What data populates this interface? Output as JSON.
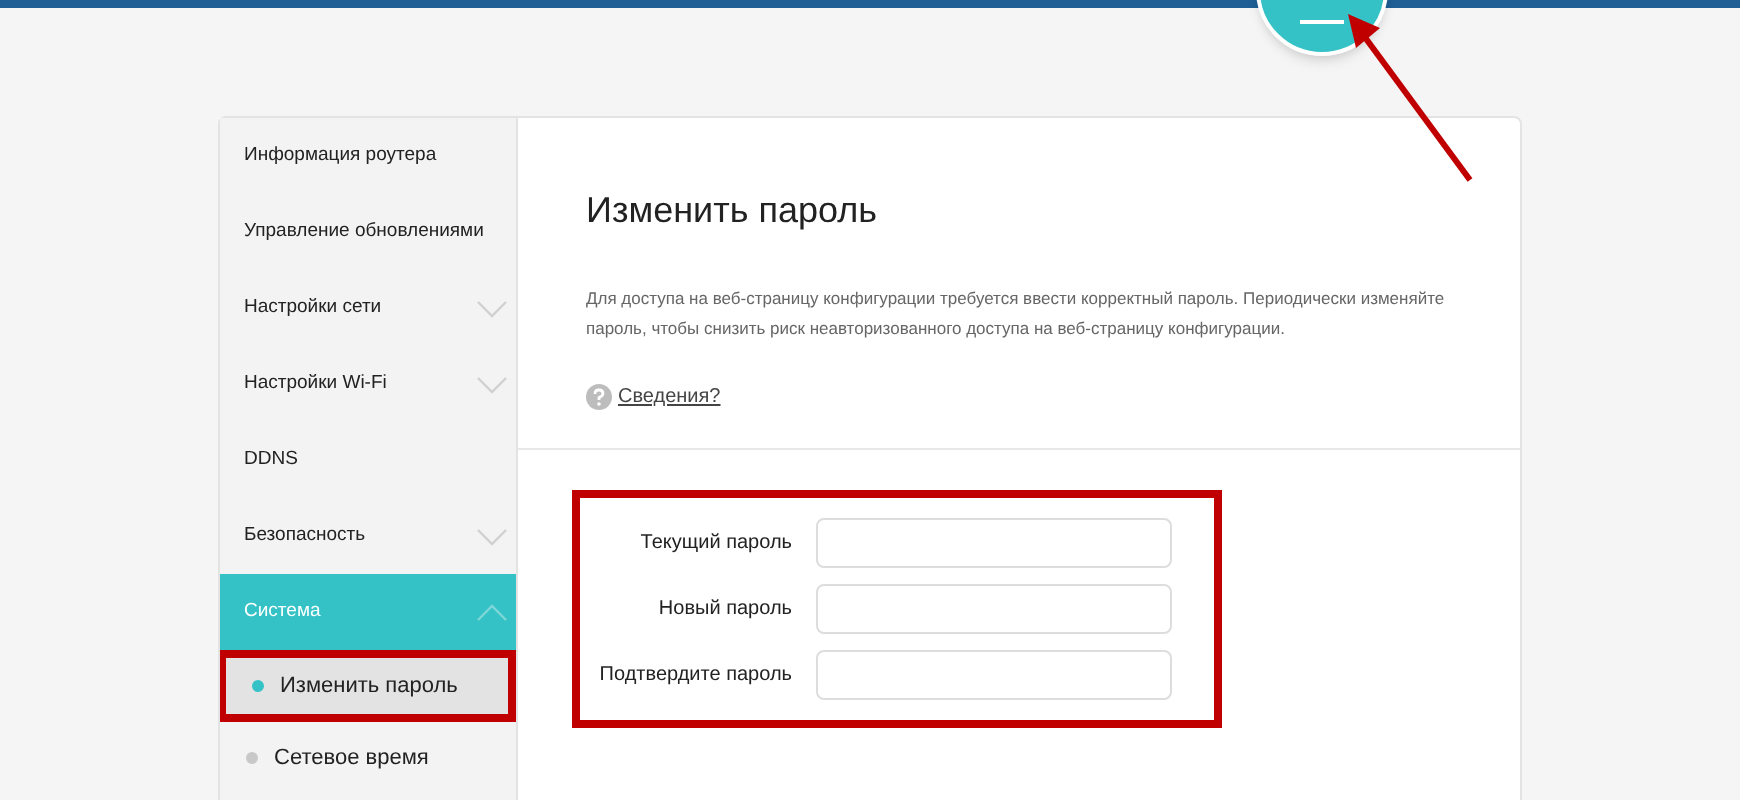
{
  "sidebar": {
    "items": [
      {
        "label": "Информация роутера",
        "kind": "item",
        "selected": false
      },
      {
        "label": "Управление обновлениями",
        "kind": "item",
        "selected": false
      },
      {
        "label": "Настройки сети",
        "kind": "group",
        "expanded": false,
        "selected": false
      },
      {
        "label": "Настройки Wi-Fi",
        "kind": "group",
        "expanded": false,
        "selected": false
      },
      {
        "label": "DDNS",
        "kind": "item",
        "selected": false
      },
      {
        "label": "Безопасность",
        "kind": "group",
        "expanded": false,
        "selected": false
      },
      {
        "label": "Система",
        "kind": "group",
        "expanded": true,
        "selected": true,
        "children": [
          {
            "label": "Изменить пароль",
            "selected": true,
            "highlighted": true
          },
          {
            "label": "Сетевое время",
            "selected": false,
            "highlighted": false
          }
        ]
      }
    ]
  },
  "content": {
    "title": "Изменить пароль",
    "description": "Для доступа на веб-страницу конфигурации требуется ввести корректный пароль. Периодически изменяйте пароль, чтобы снизить риск неавторизованного доступа на веб-страницу конфигурации.",
    "help_link": "Сведения?",
    "form": {
      "highlighted": true,
      "fields": [
        {
          "label": "Текущий пароль"
        },
        {
          "label": "Новый пароль"
        },
        {
          "label": "Подтвердите пароль"
        }
      ]
    }
  }
}
